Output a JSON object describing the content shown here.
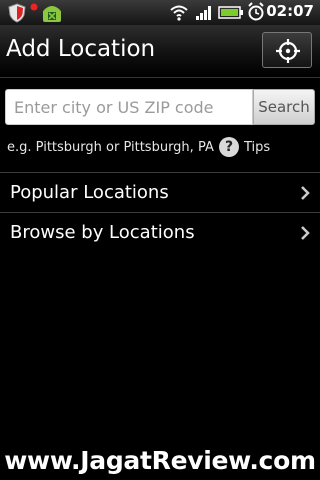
{
  "status_bar": {
    "icons": [
      "security-shield-icon",
      "android-robot-icon",
      "wifi-icon",
      "signal-icon",
      "battery-icon",
      "alarm-clock-icon"
    ],
    "time": "02:07"
  },
  "header": {
    "title": "Add Location",
    "locate_icon": "crosshair-locate-icon"
  },
  "search": {
    "placeholder": "Enter city or US ZIP code",
    "value": "",
    "button_label": "Search"
  },
  "hint": {
    "text": "e.g. Pittsburgh or Pittsburgh, PA",
    "tips_label": "Tips"
  },
  "list": [
    {
      "label": "Popular Locations"
    },
    {
      "label": "Browse by Locations"
    }
  ],
  "watermark": "www.JagatReview.com"
}
